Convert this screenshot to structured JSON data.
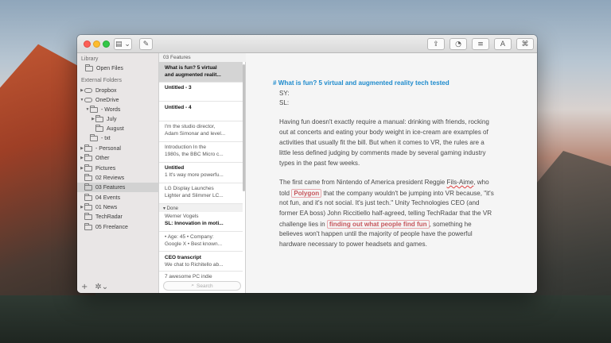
{
  "titlebar": {
    "buttons": [
      {
        "name": "sidebar-toggle-icon",
        "glyph": "▤ ⌄"
      },
      {
        "name": "compose-icon",
        "glyph": "✎"
      },
      {
        "name": "share-icon",
        "glyph": "⇪"
      },
      {
        "name": "stats-icon",
        "glyph": "◔"
      },
      {
        "name": "list-icon",
        "glyph": "≡"
      },
      {
        "name": "font-icon",
        "glyph": "A"
      },
      {
        "name": "attachment-icon",
        "glyph": "⌘"
      }
    ]
  },
  "sidebar": {
    "library_heading": "Library",
    "open_files": "Open Files",
    "external_heading": "External Folders",
    "items": [
      {
        "label": "Dropbox",
        "icon": "cloud-icon"
      },
      {
        "label": "OneDrive",
        "icon": "cloud-icon"
      },
      {
        "label": "- Words",
        "icon": "folder-icon"
      },
      {
        "label": "July",
        "icon": "folder-icon"
      },
      {
        "label": "August",
        "icon": "folder-icon"
      },
      {
        "label": "- txt",
        "icon": "folder-icon"
      },
      {
        "label": "- Personal",
        "icon": "folder-icon"
      },
      {
        "label": "Other",
        "icon": "folder-icon"
      },
      {
        "label": "Pictures",
        "icon": "folder-icon"
      },
      {
        "label": "02 Reviews",
        "icon": "folder-icon"
      },
      {
        "label": "03 Features",
        "icon": "folder-icon"
      },
      {
        "label": "04 Events",
        "icon": "folder-icon"
      },
      {
        "label": "01 News",
        "icon": "folder-icon"
      },
      {
        "label": "TechRadar",
        "icon": "folder-icon"
      },
      {
        "label": "05 Freelance",
        "icon": "folder-icon"
      }
    ],
    "footer": {
      "add": "+",
      "settings": "✲⌄"
    }
  },
  "notelist": {
    "folder_title": "03 Features",
    "notes": [
      {
        "title": "What is fun? 5 virtual",
        "line2": "and augmented realit..."
      },
      {
        "title": "Untitled - 3",
        "line2": ""
      },
      {
        "title": "Untitled - 4",
        "line2": ""
      },
      {
        "title": "",
        "line1": "I'm the studio director,",
        "line2": "Adam Simonar and level..."
      },
      {
        "title": "",
        "line1": "Introduction In the",
        "line2": "1980s, the BBC Micro c..."
      },
      {
        "title": "Untitled",
        "line2": "1 It's way more powerfu..."
      },
      {
        "title": "",
        "line1": "LG Display Launches",
        "line2": "Lighter and Slimmer LC..."
      }
    ],
    "done_label": "▾ Done",
    "done_notes": [
      {
        "line1": "Werner Vogels",
        "line2": "SL: Innovation in moti..."
      },
      {
        "line1": "• Age: 45 • Company:",
        "line2": "Google X • Best known..."
      },
      {
        "title": "CEO transcript",
        "line2": "We chat to Richitello ab..."
      },
      {
        "line1": "7 awesome PC indie",
        "line2": ""
      }
    ],
    "search_placeholder": "Search"
  },
  "editor": {
    "heading": "# What is fun? 5 virtual and augmented reality tech tested",
    "sy": "SY:",
    "sl": "SL:",
    "para1": [
      "Having fun doesn't exactly require a manual: drinking with friends, rocking",
      "out at concerts and eating your body weight in ice-cream are examples of",
      "activities that usually fit the bill. But when it comes to VR, the rules are a",
      "little less defined judging by comments made by several gaming industry",
      "types in the past few weeks."
    ],
    "p2_l1_a": "The first came from Nintendo of America president Reggie ",
    "p2_l1_b": "Fils-Aime",
    "p2_l1_c": ", who",
    "p2_l2_a": "told ",
    "p2_l2_link": "Polygon",
    "p2_l2_b": " that the company wouldn't be jumping into VR because, \"it's",
    "p2_l3": "not fun, and it's not social. It's just tech.\" Unity Technologies CEO (and",
    "p2_l4": "former EA boss) John Riccitiello half-agreed, telling TechRadar that the VR",
    "p2_l5_a": "challenge lies in ",
    "p2_l5_link": "finding out what people find fun",
    "p2_l5_b": ", something he",
    "p2_l6": "believes won't happen until the majority of people have the powerful",
    "p2_l7": "hardware necessary to power headsets and games."
  }
}
